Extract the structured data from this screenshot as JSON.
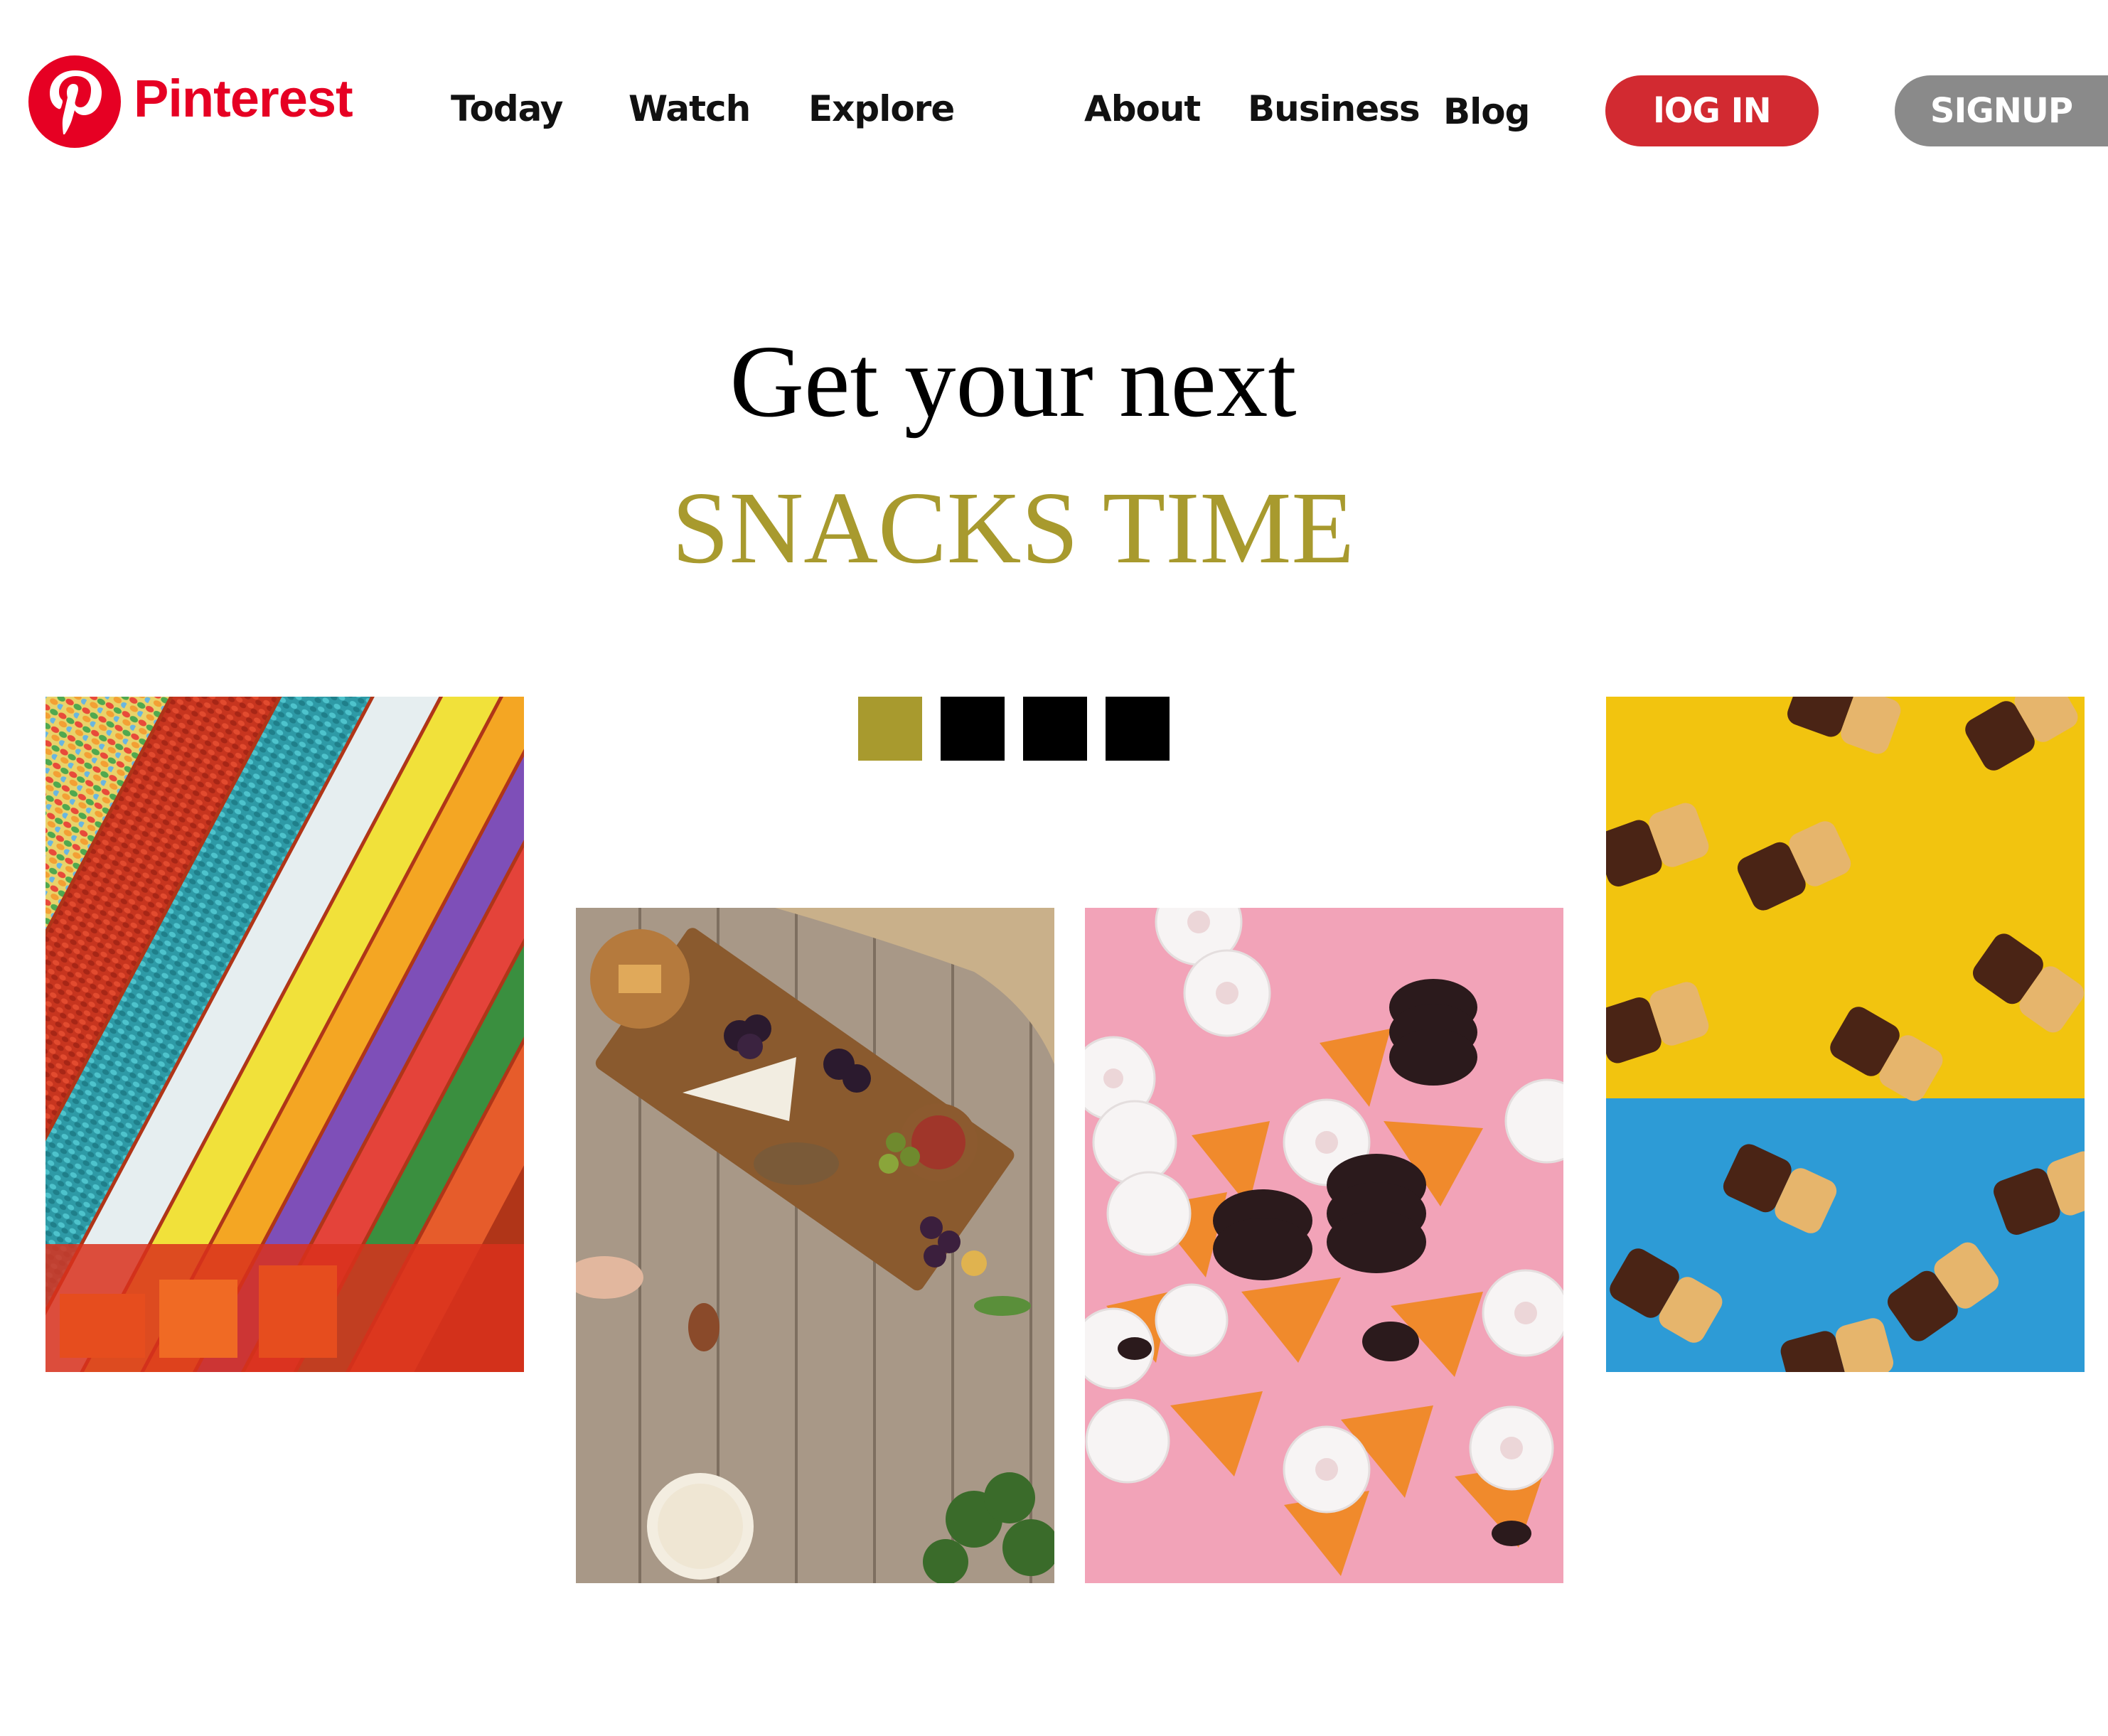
{
  "header": {
    "brand_name": "Pinterest",
    "brand_color": "#e60023",
    "logo_icon": "pinterest-logo-icon",
    "nav": {
      "today": "Today",
      "watch": "Watch",
      "explore": "Explore",
      "about": "About",
      "business": "Business",
      "blog": "Blog"
    },
    "login_label": "lOG IN",
    "signup_label": "SIGNUP",
    "login_color": "#d22a31",
    "signup_color": "#8a8a8a"
  },
  "hero": {
    "line1": "Get your next",
    "line2": "SNACKS TIME",
    "accent_color": "#a89a2e"
  },
  "carousel": {
    "dot_count": 4,
    "active_index": 0
  },
  "gallery": {
    "images": [
      {
        "name": "jelly-beans-dispensers-image",
        "subject": "rainbow jelly bean dispensers"
      },
      {
        "name": "charcuterie-board-image",
        "subject": "charcuterie board on wooden table"
      },
      {
        "name": "donuts-oreos-chips-image",
        "subject": "powdered donuts, oreos and chips on pink"
      },
      {
        "name": "chocolate-wafer-rolls-image",
        "subject": "chocolate dipped wafer rolls on yellow and blue"
      }
    ]
  }
}
